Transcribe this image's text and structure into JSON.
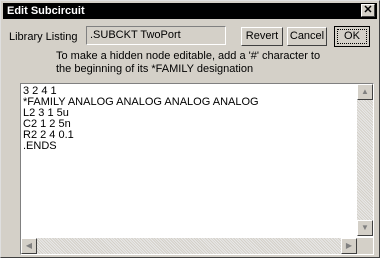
{
  "window": {
    "title": "Edit Subcircuit",
    "close_glyph": "✕"
  },
  "library": {
    "label": "Library Listing",
    "value": ".SUBCKT TwoPort"
  },
  "buttons": {
    "revert": "Revert",
    "cancel": "Cancel",
    "ok": "OK"
  },
  "hint": {
    "line1": "To make a hidden node editable, add a '#' character to",
    "line2": "the beginning of its *FAMILY designation"
  },
  "editor": {
    "text": "3 2 4 1\n*FAMILY ANALOG ANALOG ANALOG ANALOG\nL2 3 1 5u\nC2 1 2 5n\nR2 2 4 0.1\n.ENDS"
  },
  "scrollbars": {
    "up_icon": "arrow-up-icon",
    "down_icon": "arrow-down-icon",
    "left_icon": "arrow-left-icon",
    "right_icon": "arrow-right-icon"
  }
}
